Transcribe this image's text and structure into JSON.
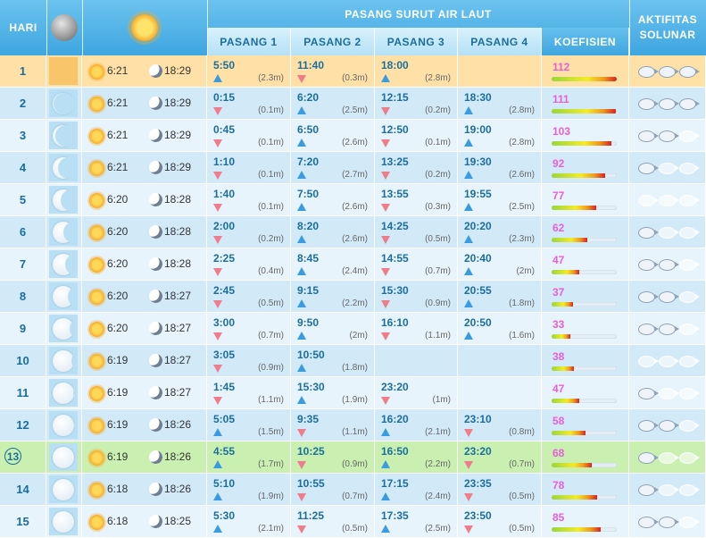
{
  "header": {
    "hari": "HARI",
    "group_title": "PASANG SURUT AIR LAUT",
    "pasang_labels": [
      "PASANG 1",
      "PASANG 2",
      "PASANG 3",
      "PASANG 4"
    ],
    "koefisien": "KOEFISIEN",
    "aktifitas": "AKTIFITAS SOLUNAR"
  },
  "colors": {
    "header_blue": "#4bb0e6",
    "subheader_bg": "#c8e9f9",
    "row_light": "#e8f4fb",
    "row_dark": "#d2eaf8",
    "row_today_highlight": "#ffe1a8",
    "row_current": "#c9f0b1",
    "rising": "#3a9be0",
    "falling": "#ef7c8a",
    "coef_text": "#e85ed5",
    "day_text": "#1a6e9e"
  },
  "days": [
    {
      "day": "1",
      "moon_phase": 0.0,
      "sunrise": "6:21",
      "sunset": "18:29",
      "tides": [
        {
          "time": "5:50",
          "dir": "up",
          "h": "(2.3m)"
        },
        {
          "time": "11:40",
          "dir": "down",
          "h": "(0.3m)"
        },
        {
          "time": "18:00",
          "dir": "up",
          "h": "(2.8m)"
        },
        null
      ],
      "coef": "112",
      "coef_level": 1.0,
      "solunar": [
        1,
        1,
        1
      ]
    },
    {
      "day": "2",
      "moon_phase": 0.03,
      "sunrise": "6:21",
      "sunset": "18:29",
      "tides": [
        {
          "time": "0:15",
          "dir": "down",
          "h": "(0.1m)"
        },
        {
          "time": "6:20",
          "dir": "up",
          "h": "(2.5m)"
        },
        {
          "time": "12:15",
          "dir": "down",
          "h": "(0.2m)"
        },
        {
          "time": "18:30",
          "dir": "up",
          "h": "(2.8m)"
        }
      ],
      "coef": "111",
      "coef_level": 0.99,
      "solunar": [
        1,
        1,
        1
      ]
    },
    {
      "day": "3",
      "moon_phase": 0.07,
      "sunrise": "6:21",
      "sunset": "18:29",
      "tides": [
        {
          "time": "0:45",
          "dir": "down",
          "h": "(0.1m)"
        },
        {
          "time": "6:50",
          "dir": "up",
          "h": "(2.6m)"
        },
        {
          "time": "12:50",
          "dir": "down",
          "h": "(0.1m)"
        },
        {
          "time": "19:00",
          "dir": "up",
          "h": "(2.8m)"
        }
      ],
      "coef": "103",
      "coef_level": 0.92,
      "solunar": [
        1,
        1,
        0
      ]
    },
    {
      "day": "4",
      "moon_phase": 0.12,
      "sunrise": "6:21",
      "sunset": "18:29",
      "tides": [
        {
          "time": "1:10",
          "dir": "down",
          "h": "(0.1m)"
        },
        {
          "time": "7:20",
          "dir": "up",
          "h": "(2.7m)"
        },
        {
          "time": "13:25",
          "dir": "down",
          "h": "(0.2m)"
        },
        {
          "time": "19:30",
          "dir": "up",
          "h": "(2.6m)"
        }
      ],
      "coef": "92",
      "coef_level": 0.82,
      "solunar": [
        1,
        0,
        0
      ]
    },
    {
      "day": "5",
      "moon_phase": 0.18,
      "sunrise": "6:20",
      "sunset": "18:28",
      "tides": [
        {
          "time": "1:40",
          "dir": "down",
          "h": "(0.1m)"
        },
        {
          "time": "7:50",
          "dir": "up",
          "h": "(2.6m)"
        },
        {
          "time": "13:55",
          "dir": "down",
          "h": "(0.3m)"
        },
        {
          "time": "19:55",
          "dir": "up",
          "h": "(2.5m)"
        }
      ],
      "coef": "77",
      "coef_level": 0.69,
      "solunar": [
        0,
        0,
        0
      ]
    },
    {
      "day": "6",
      "moon_phase": 0.25,
      "sunrise": "6:20",
      "sunset": "18:28",
      "tides": [
        {
          "time": "2:00",
          "dir": "down",
          "h": "(0.2m)"
        },
        {
          "time": "8:20",
          "dir": "up",
          "h": "(2.6m)"
        },
        {
          "time": "14:25",
          "dir": "down",
          "h": "(0.5m)"
        },
        {
          "time": "20:20",
          "dir": "up",
          "h": "(2.3m)"
        }
      ],
      "coef": "62",
      "coef_level": 0.55,
      "solunar": [
        1,
        0,
        0
      ]
    },
    {
      "day": "7",
      "moon_phase": 0.3,
      "sunrise": "6:20",
      "sunset": "18:28",
      "tides": [
        {
          "time": "2:25",
          "dir": "down",
          "h": "(0.4m)"
        },
        {
          "time": "8:45",
          "dir": "up",
          "h": "(2.4m)"
        },
        {
          "time": "14:55",
          "dir": "down",
          "h": "(0.7m)"
        },
        {
          "time": "20:40",
          "dir": "up",
          "h": "(2m)"
        }
      ],
      "coef": "47",
      "coef_level": 0.42,
      "solunar": [
        1,
        1,
        0
      ]
    },
    {
      "day": "8",
      "moon_phase": 0.35,
      "sunrise": "6:20",
      "sunset": "18:27",
      "tides": [
        {
          "time": "2:45",
          "dir": "down",
          "h": "(0.5m)"
        },
        {
          "time": "9:15",
          "dir": "up",
          "h": "(2.2m)"
        },
        {
          "time": "15:30",
          "dir": "down",
          "h": "(0.9m)"
        },
        {
          "time": "20:55",
          "dir": "up",
          "h": "(1.8m)"
        }
      ],
      "coef": "37",
      "coef_level": 0.33,
      "solunar": [
        1,
        1,
        0
      ]
    },
    {
      "day": "9",
      "moon_phase": 0.4,
      "sunrise": "6:20",
      "sunset": "18:27",
      "tides": [
        {
          "time": "3:00",
          "dir": "down",
          "h": "(0.7m)"
        },
        {
          "time": "9:50",
          "dir": "up",
          "h": "(2m)"
        },
        {
          "time": "16:10",
          "dir": "down",
          "h": "(1.1m)"
        },
        {
          "time": "20:50",
          "dir": "up",
          "h": "(1.6m)"
        }
      ],
      "coef": "33",
      "coef_level": 0.29,
      "solunar": [
        1,
        1,
        0
      ]
    },
    {
      "day": "10",
      "moon_phase": 0.44,
      "sunrise": "6:19",
      "sunset": "18:27",
      "tides": [
        {
          "time": "3:05",
          "dir": "down",
          "h": "(0.9m)"
        },
        {
          "time": "10:50",
          "dir": "up",
          "h": "(1.8m)"
        },
        null,
        null
      ],
      "coef": "38",
      "coef_level": 0.34,
      "solunar": [
        0,
        0,
        0
      ]
    },
    {
      "day": "11",
      "moon_phase": 0.47,
      "sunrise": "6:19",
      "sunset": "18:27",
      "tides": [
        {
          "time": "1:45",
          "dir": "down",
          "h": "(1.1m)"
        },
        {
          "time": "15:30",
          "dir": "up",
          "h": "(1.9m)"
        },
        {
          "time": "23:20",
          "dir": "down",
          "h": "(1m)"
        },
        null
      ],
      "coef": "47",
      "coef_level": 0.42,
      "solunar": [
        1,
        0,
        0
      ]
    },
    {
      "day": "12",
      "moon_phase": 0.49,
      "sunrise": "6:19",
      "sunset": "18:26",
      "tides": [
        {
          "time": "5:05",
          "dir": "up",
          "h": "(1.5m)"
        },
        {
          "time": "9:35",
          "dir": "down",
          "h": "(1.1m)"
        },
        {
          "time": "16:20",
          "dir": "up",
          "h": "(2.1m)"
        },
        {
          "time": "23:10",
          "dir": "down",
          "h": "(0.8m)"
        }
      ],
      "coef": "58",
      "coef_level": 0.52,
      "solunar": [
        1,
        1,
        0
      ]
    },
    {
      "day": "13",
      "moon_phase": 0.5,
      "sunrise": "6:19",
      "sunset": "18:26",
      "tides": [
        {
          "time": "4:55",
          "dir": "up",
          "h": "(1.7m)"
        },
        {
          "time": "10:25",
          "dir": "down",
          "h": "(0.9m)"
        },
        {
          "time": "16:50",
          "dir": "up",
          "h": "(2.2m)"
        },
        {
          "time": "23:20",
          "dir": "down",
          "h": "(0.7m)"
        }
      ],
      "coef": "68",
      "coef_level": 0.61,
      "solunar": [
        1,
        0,
        0
      ]
    },
    {
      "day": "14",
      "moon_phase": 0.5,
      "sunrise": "6:18",
      "sunset": "18:26",
      "tides": [
        {
          "time": "5:10",
          "dir": "up",
          "h": "(1.9m)"
        },
        {
          "time": "10:55",
          "dir": "down",
          "h": "(0.7m)"
        },
        {
          "time": "17:15",
          "dir": "up",
          "h": "(2.4m)"
        },
        {
          "time": "23:35",
          "dir": "down",
          "h": "(0.5m)"
        }
      ],
      "coef": "78",
      "coef_level": 0.7,
      "solunar": [
        1,
        0,
        0
      ]
    },
    {
      "day": "15",
      "moon_phase": 0.5,
      "sunrise": "6:18",
      "sunset": "18:25",
      "tides": [
        {
          "time": "5:30",
          "dir": "up",
          "h": "(2.1m)"
        },
        {
          "time": "11:25",
          "dir": "down",
          "h": "(0.5m)"
        },
        {
          "time": "17:35",
          "dir": "up",
          "h": "(2.5m)"
        },
        {
          "time": "23:50",
          "dir": "down",
          "h": "(0.5m)"
        }
      ],
      "coef": "85",
      "coef_level": 0.76,
      "solunar": [
        1,
        1,
        0
      ]
    }
  ]
}
